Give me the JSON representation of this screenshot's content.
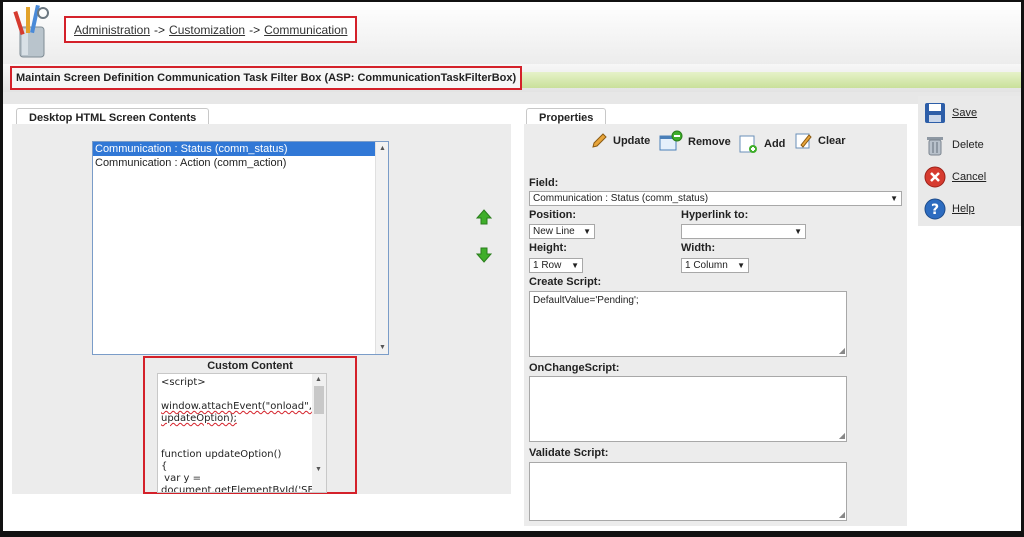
{
  "breadcrumb": {
    "items": [
      "Administration",
      "Customization",
      "Communication"
    ],
    "separator": "->"
  },
  "page_title": "Maintain Screen Definition Communication Task Filter Box (ASP: CommunicationTaskFilterBox)",
  "left_panel": {
    "tab_label": "Desktop HTML Screen Contents",
    "list_items": [
      "Communication : Status (comm_status)",
      "Communication : Action (comm_action)"
    ],
    "custom_content_label": "Custom Content",
    "custom_content_lines": [
      "<script>",
      "",
      "window.attachEvent(\"onload\",",
      "updateOption);",
      "",
      "",
      "function updateOption()",
      "{",
      " var y =",
      "document.getElementById('SELE"
    ]
  },
  "right_panel": {
    "tab_label": "Properties",
    "toolbar": {
      "update": "Update",
      "remove": "Remove",
      "add": "Add",
      "clear": "Clear"
    },
    "field_label": "Field:",
    "field_value": "Communication : Status (comm_status)",
    "position_label": "Position:",
    "position_value": "New Line",
    "hyperlink_label": "Hyperlink to:",
    "hyperlink_value": "",
    "height_label": "Height:",
    "height_value": "1 Row",
    "width_label": "Width:",
    "width_value": "1 Column",
    "create_script_label": "Create Script:",
    "create_script_value": "DefaultValue='Pending';",
    "onchange_label": "OnChangeScript:",
    "onchange_value": "",
    "validate_label": "Validate Script:",
    "validate_value": ""
  },
  "side_actions": {
    "save": "Save",
    "delete": "Delete",
    "cancel": "Cancel",
    "help": "Help"
  },
  "colors": {
    "highlight_border": "#d4212a",
    "selected_row": "#3178d6",
    "green_bar": "#c9e09a"
  }
}
